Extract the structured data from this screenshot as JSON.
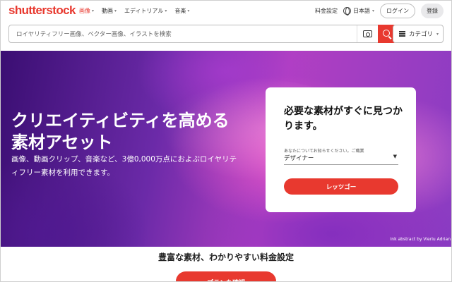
{
  "brand": {
    "logo": "shutterstock",
    "accent": "#e8392f"
  },
  "nav": {
    "items": [
      {
        "label": "画像",
        "active": true
      },
      {
        "label": "動画",
        "active": false
      },
      {
        "label": "エディトリアル",
        "active": false
      },
      {
        "label": "音楽",
        "active": false
      }
    ],
    "pricing": "料金設定",
    "language": "日本語",
    "login": "ログイン",
    "signup": "登録"
  },
  "search": {
    "placeholder": "ロイヤリティフリー画像、ベクター画像、イラストを検索",
    "category_label": "カテゴリ"
  },
  "hero": {
    "title": "クリエイティビティを高める素材アセット",
    "subtitle": "画像、動画クリップ、音楽など、3億0,000万点におよぶロイヤリティフリー素材を利用できます。",
    "credit": "Ink abstract by Vieriu Adrian"
  },
  "card": {
    "title": "必要な素材がすぐに見つかります。",
    "select_label": "あなたについてお知らせください。ご職業",
    "select_value": "デザイナー",
    "cta": "レッツゴー"
  },
  "section": {
    "heading": "豊富な素材、わかりやすい料金設定",
    "plan_button": "プランを確認"
  }
}
